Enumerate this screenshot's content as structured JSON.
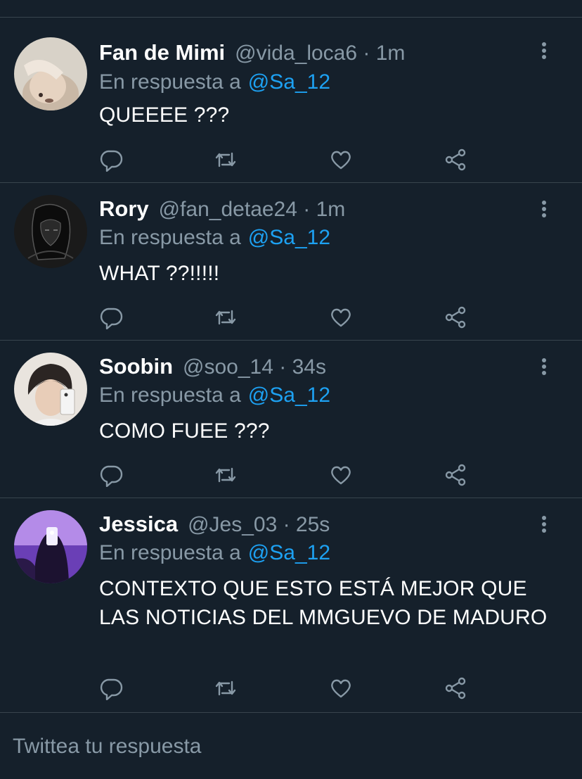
{
  "colors": {
    "background": "#15202b",
    "divider": "#38444d",
    "secondary_text": "#8899a6",
    "link": "#1da1f2"
  },
  "tweets": [
    {
      "name": "Fan de Mimi",
      "handle_meta": "@vida_loca6 · 1m",
      "reply_prefix": "En respuesta a",
      "reply_to": "@Sa_12",
      "text": "QUEEEE ???",
      "avatar": "avatar-fan-de-mimi"
    },
    {
      "name": "Rory",
      "handle_meta": "@fan_detae24 · 1m",
      "reply_prefix": "En respuesta a",
      "reply_to": "@Sa_12",
      "text": "WHAT ??!!!!!",
      "avatar": "avatar-rory"
    },
    {
      "name": "Soobin",
      "handle_meta": "@soo_14 · 34s",
      "reply_prefix": "En respuesta a",
      "reply_to": "@Sa_12",
      "text": "COMO FUEE ???",
      "avatar": "avatar-soobin"
    },
    {
      "name": "Jessica",
      "handle_meta": "@Jes_03 · 25s",
      "reply_prefix": "En respuesta a",
      "reply_to": "@Sa_12",
      "text": "CONTEXTO QUE ESTO ESTÁ MEJOR QUE LAS NOTICIAS DEL MMGUEVO DE MADURO",
      "avatar": "avatar-jessica"
    }
  ],
  "icons": {
    "reply": "reply-icon",
    "retweet": "retweet-icon",
    "like": "heart-icon",
    "share": "share-icon",
    "more": "more-vertical-icon"
  },
  "composer": {
    "placeholder": "Twittea tu respuesta"
  }
}
